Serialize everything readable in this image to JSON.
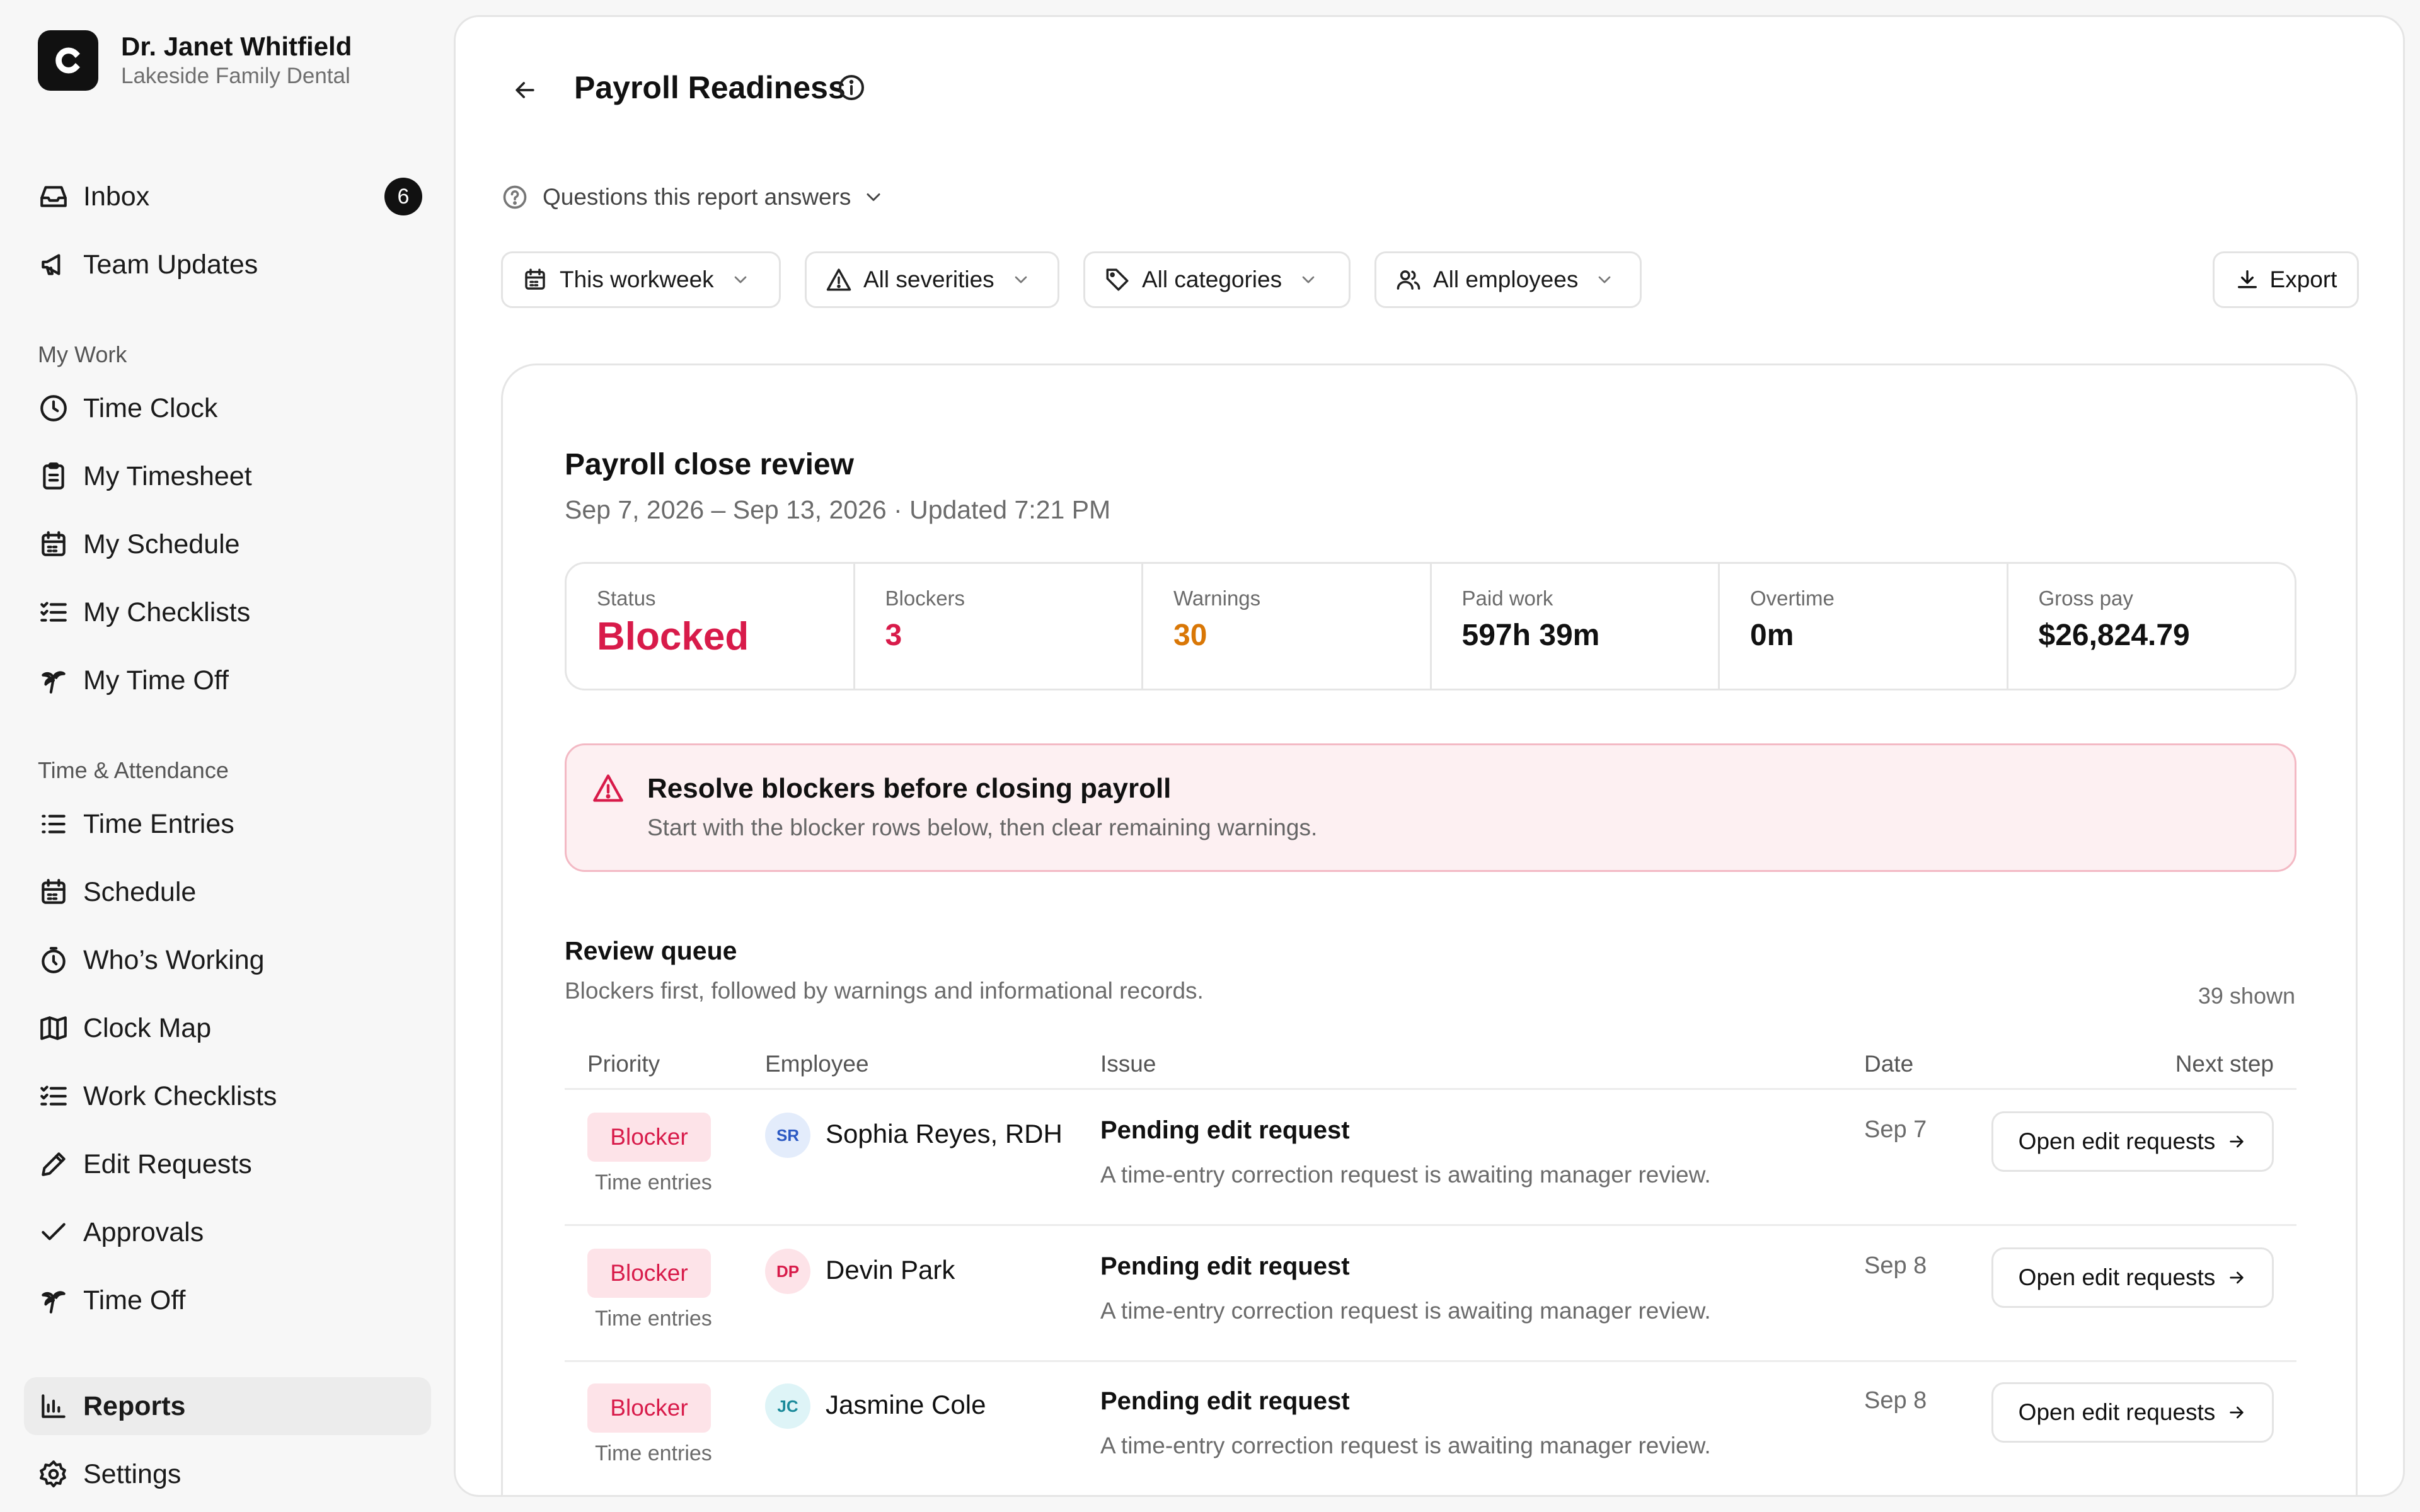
{
  "account": {
    "name": "Dr. Janet Whitfield",
    "org": "Lakeside Family Dental",
    "logo_letter": "C"
  },
  "nav": {
    "top": [
      {
        "label": "Inbox",
        "icon": "inbox-icon",
        "badge": "6"
      },
      {
        "label": "Team Updates",
        "icon": "megaphone-icon"
      }
    ],
    "my_work_label": "My Work",
    "my_work": [
      {
        "label": "Time Clock",
        "icon": "clock-icon"
      },
      {
        "label": "My Timesheet",
        "icon": "clipboard-icon"
      },
      {
        "label": "My Schedule",
        "icon": "calendar-icon"
      },
      {
        "label": "My Checklists",
        "icon": "checklist-icon"
      },
      {
        "label": "My Time Off",
        "icon": "palm-tree-icon"
      }
    ],
    "ta_label": "Time & Attendance",
    "time_attendance": [
      {
        "label": "Time Entries",
        "icon": "list-icon"
      },
      {
        "label": "Schedule",
        "icon": "calendar-icon"
      },
      {
        "label": "Who’s Working",
        "icon": "stopwatch-icon"
      },
      {
        "label": "Clock Map",
        "icon": "map-icon"
      },
      {
        "label": "Work Checklists",
        "icon": "checklist-icon"
      },
      {
        "label": "Edit Requests",
        "icon": "pencil-icon"
      },
      {
        "label": "Approvals",
        "icon": "check-icon"
      },
      {
        "label": "Time Off",
        "icon": "palm-tree-icon"
      }
    ],
    "bottom": [
      {
        "label": "Reports",
        "icon": "bar-chart-icon",
        "active": true
      },
      {
        "label": "Settings",
        "icon": "gear-icon"
      }
    ]
  },
  "header": {
    "title": "Payroll Readiness"
  },
  "questions_label": "Questions this report answers",
  "filters": {
    "period": "This workweek",
    "severity": "All severities",
    "category": "All categories",
    "employees": "All employees",
    "export": "Export"
  },
  "report": {
    "title": "Payroll close review",
    "subtitle": "Sep 7, 2026 – Sep 13, 2026 · Updated 7:21 PM",
    "stats": [
      {
        "label": "Status",
        "value": "Blocked",
        "color": "#d81b4a"
      },
      {
        "label": "Blockers",
        "value": "3",
        "color": "#d81b4a"
      },
      {
        "label": "Warnings",
        "value": "30",
        "color": "#d97706"
      },
      {
        "label": "Paid work",
        "value": "597h 39m",
        "color": "#111111"
      },
      {
        "label": "Overtime",
        "value": "0m",
        "color": "#111111"
      },
      {
        "label": "Gross pay",
        "value": "$26,824.79",
        "color": "#111111"
      }
    ],
    "alert": {
      "title": "Resolve blockers before closing payroll",
      "body": "Start with the blocker rows below, then clear remaining warnings."
    }
  },
  "queue": {
    "title": "Review queue",
    "subtitle": "Blockers first, followed by warnings and informational records.",
    "count": "39 shown",
    "columns": {
      "priority": "Priority",
      "employee": "Employee",
      "issue": "Issue",
      "date": "Date",
      "next": "Next step"
    },
    "rows": [
      {
        "priority": "Blocker",
        "category": "Time entries",
        "initials": "SR",
        "avatar_bg": "#e3ecfb",
        "avatar_fg": "#2b59c3",
        "employee": "Sophia Reyes, RDH",
        "issue": "Pending edit request",
        "desc": "A time-entry correction request is awaiting manager review.",
        "date": "Sep 7",
        "action": "Open edit requests"
      },
      {
        "priority": "Blocker",
        "category": "Time entries",
        "initials": "DP",
        "avatar_bg": "#fde3e8",
        "avatar_fg": "#d81b4a",
        "employee": "Devin Park",
        "issue": "Pending edit request",
        "desc": "A time-entry correction request is awaiting manager review.",
        "date": "Sep 8",
        "action": "Open edit requests"
      },
      {
        "priority": "Blocker",
        "category": "Time entries",
        "initials": "JC",
        "avatar_bg": "#def4f7",
        "avatar_fg": "#1b8a9a",
        "employee": "Jasmine Cole",
        "issue": "Pending edit request",
        "desc": "A time-entry correction request is awaiting manager review.",
        "date": "Sep 8",
        "action": "Open edit requests"
      }
    ]
  }
}
